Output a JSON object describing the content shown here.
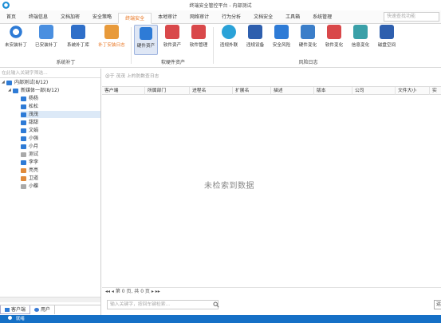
{
  "window": {
    "title": "终端安全管控平台 - 内部测试"
  },
  "menubar": {
    "items": [
      "首页",
      "终端信息",
      "文档加密",
      "安全策略",
      "终端安全",
      "本地审计",
      "网络审计",
      "行为分析",
      "文档安全",
      "工具箱",
      "系统管理"
    ],
    "active_index": 4,
    "search_placeholder": "快速查找功能"
  },
  "ribbon": {
    "groups": [
      {
        "label": "系统补丁",
        "buttons": [
          "未安装补丁",
          "已安装补丁",
          "系统补丁库",
          "补丁安装日志"
        ]
      },
      {
        "label": "软硬件资产",
        "buttons": [
          "硬件资产",
          "软件资产",
          "软件管理"
        ]
      },
      {
        "label": "风险日志",
        "buttons": [
          "违规外联",
          "违规设备",
          "安全风险",
          "硬件变化",
          "软件变化",
          "信息变化",
          "磁盘空间"
        ]
      }
    ],
    "active_button": "硬件资产",
    "highlight_button": "补丁安装日志"
  },
  "tree": {
    "filter_placeholder": "在此输入关键字筛选...",
    "root": "内部测试(8/12)",
    "group": "新媒体一部(8/12)",
    "nodes": [
      "杨杨",
      "松松",
      "茂茂",
      "甜甜",
      "文娟",
      "小强",
      "小月",
      "测试",
      "李李",
      "亮亮",
      "卫道",
      "小蝶"
    ],
    "selected_index": 2
  },
  "left_tabs": {
    "items": [
      "客户端",
      "用户"
    ],
    "active_index": 0
  },
  "grid": {
    "hint": "@于 茂茂 上的防数查日志",
    "columns": [
      "客户端",
      "所属部门",
      "进程名",
      "扩展名",
      "描述",
      "版本",
      "公司",
      "文件大小",
      "实"
    ],
    "empty_text": "未检索到数据",
    "pager": "◂◂ ◂ 第 0 页, 共 0 页 ▸ ▸▸"
  },
  "bottom": {
    "search_placeholder": "输入关键字，按回车键检索...",
    "button_label": "运"
  },
  "status": {
    "text": "就绪"
  },
  "colors": {
    "accent": "#e8731d",
    "status_bar": "#1570c6",
    "selection": "#dce9f7"
  }
}
